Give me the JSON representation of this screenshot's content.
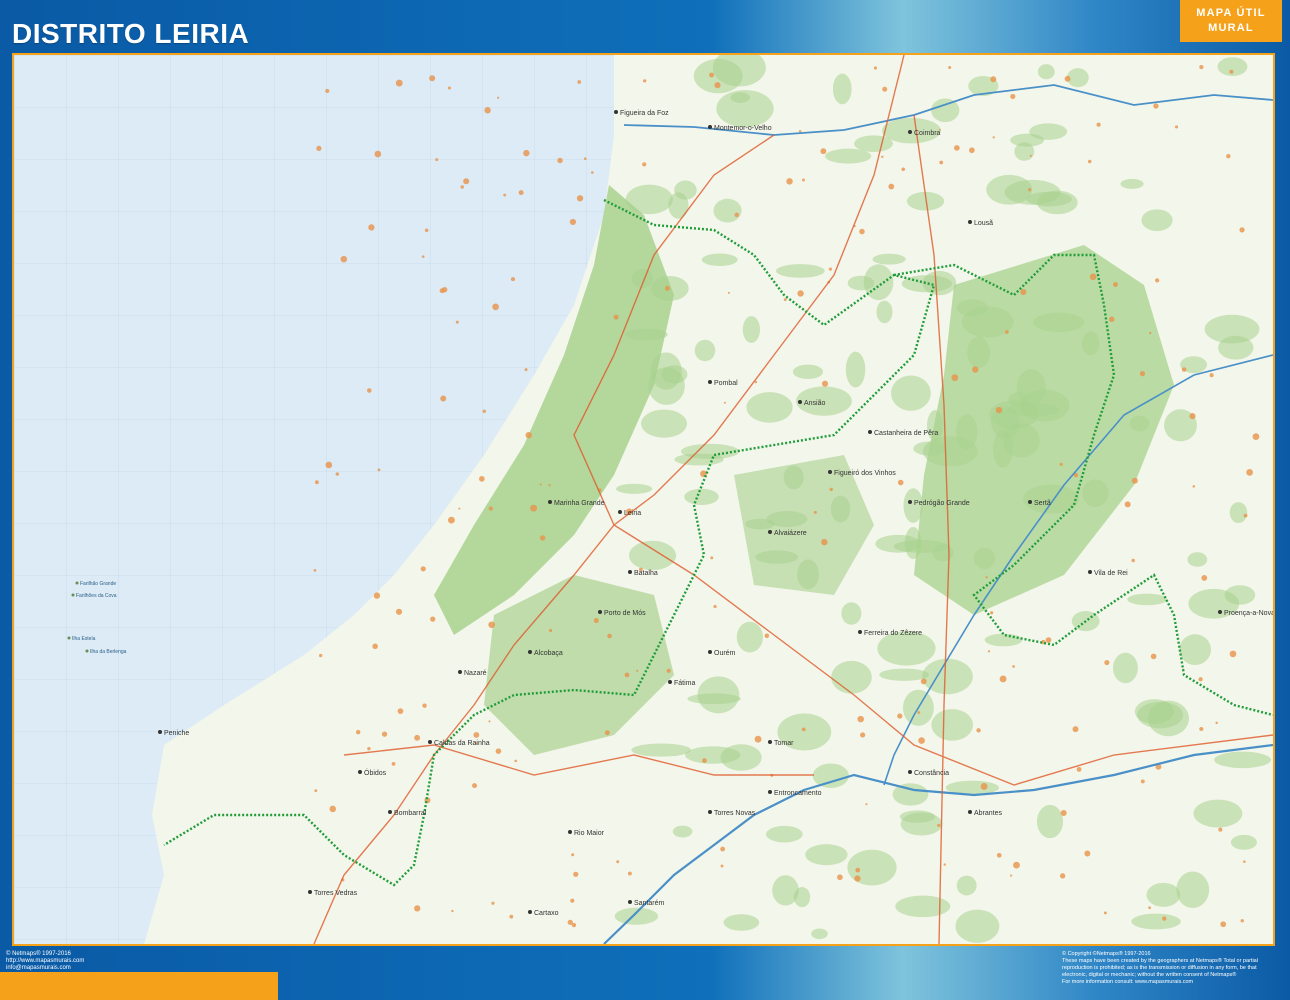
{
  "header": {
    "title": "DISTRITO LEIRIA",
    "badge_line1": "MAPA ÚTIL",
    "badge_line2": "MURAL"
  },
  "map": {
    "place_labels": [
      "Figueira da Foz",
      "Montemor-o-Velho",
      "Coimbra",
      "Lousã",
      "Pombal",
      "Ansião",
      "Leiria",
      "Marinha Grande",
      "Batalha",
      "Porto de Mós",
      "Alcobaça",
      "Nazaré",
      "Caldas da Rainha",
      "Óbidos",
      "Peniche",
      "Bombarral",
      "Torres Vedras",
      "Rio Maior",
      "Santarém",
      "Tomar",
      "Ourém",
      "Fátima",
      "Abrantes",
      "Alvaiázere",
      "Pedrógão Grande",
      "Figueiró dos Vinhos",
      "Castanheira de Pêra",
      "Sertã",
      "Ferreira do Zêzere",
      "Constância",
      "Entroncamento",
      "Torres Novas",
      "Cartaxo",
      "Vila de Rei",
      "Proença-a-Nova"
    ],
    "islands": [
      "Farilhão Grande",
      "Farilhões da Cova",
      "Ilha Estela",
      "Ilha da Berlenga"
    ],
    "colors": {
      "sea": "#dcebf5",
      "land": "#f3f6ea",
      "forest": "#a8d18e",
      "road": "#e05a2b",
      "boundary": "#1f9d3a",
      "river": "#4a90c8",
      "urban": "#e8924a"
    }
  },
  "footer": {
    "left_line1": "© Netmaps® 1997-2016",
    "left_line2": "http://www.mapasmurais.com",
    "left_line3": "info@mapasmurais.com",
    "right_line1": "© Copyright ©Netmaps® 1997-2016",
    "right_line2": "These maps have been created by the geographers at Netmaps® Total or partial",
    "right_line3": "reproduction is prohibited; as is the transmission or diffusion in any form, be that",
    "right_line4": "electronic, digital or mechanic; without the written consent of Netmaps®",
    "right_line5": "For more information consult: www.mapasmurais.com"
  }
}
